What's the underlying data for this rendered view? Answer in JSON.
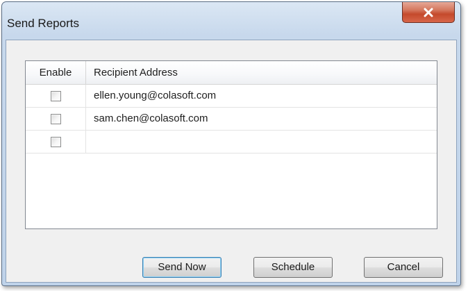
{
  "window": {
    "title": "Send Reports"
  },
  "icons": {
    "close": "close-icon"
  },
  "table": {
    "columns": [
      "Enable",
      "Recipient Address"
    ],
    "rows": [
      {
        "enabled": false,
        "address": "ellen.young@colasoft.com"
      },
      {
        "enabled": false,
        "address": "sam.chen@colasoft.com"
      },
      {
        "enabled": false,
        "address": ""
      }
    ]
  },
  "buttons": {
    "send_now": "Send Now",
    "schedule": "Schedule",
    "cancel": "Cancel"
  },
  "colors": {
    "close_button": "#c44a2c",
    "default_button_border": "#3c7fb1"
  }
}
